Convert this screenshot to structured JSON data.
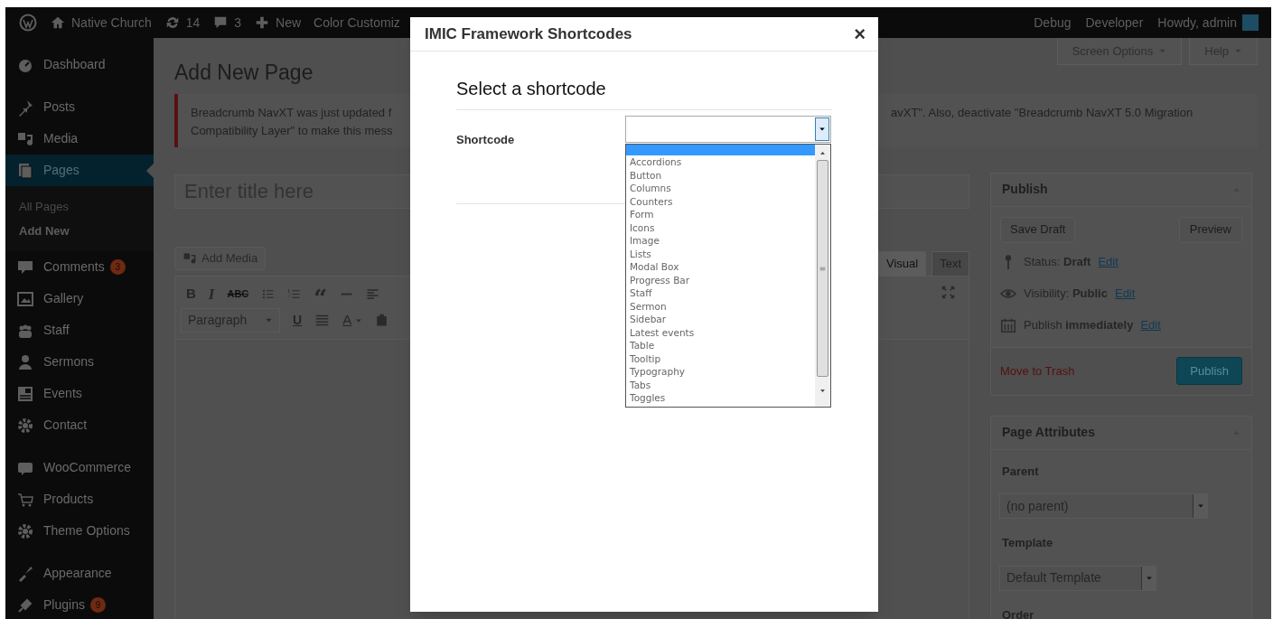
{
  "admin_bar": {
    "left": [
      {
        "label": "Native Church"
      },
      {
        "label": "14"
      },
      {
        "label": "3"
      },
      {
        "label": "New"
      },
      {
        "label": "Color Customiz"
      }
    ],
    "right": [
      "Debug",
      "Developer",
      "Howdy, admin"
    ]
  },
  "sidebar": {
    "groups": [
      [
        {
          "label": "Dashboard",
          "selected": false
        }
      ],
      [
        {
          "label": "Posts",
          "selected": false
        },
        {
          "label": "Media",
          "selected": false
        },
        {
          "label": "Pages",
          "selected": true,
          "children": [
            {
              "label": "All Pages",
              "selected": false
            },
            {
              "label": "Add New",
              "selected": true
            }
          ]
        },
        {
          "label": "Comments",
          "selected": false,
          "badge": "3"
        },
        {
          "label": "Gallery",
          "selected": false
        },
        {
          "label": "Staff",
          "selected": false
        },
        {
          "label": "Sermons",
          "selected": false
        },
        {
          "label": "Events",
          "selected": false
        },
        {
          "label": "Contact",
          "selected": false
        }
      ],
      [
        {
          "label": "WooCommerce",
          "selected": false
        },
        {
          "label": "Products",
          "selected": false
        },
        {
          "label": "Theme Options",
          "selected": false
        }
      ],
      [
        {
          "label": "Appearance",
          "selected": false
        },
        {
          "label": "Plugins",
          "selected": false,
          "badge": "9"
        }
      ]
    ]
  },
  "page_title": "Add New Page",
  "screen_tabs": [
    "Screen Options",
    "Help"
  ],
  "notice": {
    "left_lines": [
      "Breadcrumb NavXT was just updated f",
      "Compatibility Layer\" to make this mess"
    ],
    "right_lines": [
      "avXT\". Also, deactivate \"Breadcrumb NavXT 5.0 Migration"
    ]
  },
  "title_field": {
    "placeholder": "Enter title here"
  },
  "editor": {
    "add_media": "Add Media",
    "tabs": [
      {
        "label": "Visual",
        "selected": true
      },
      {
        "label": "Text",
        "selected": false
      }
    ],
    "glyphs": {
      "bold": "B",
      "italic": "I",
      "strike": "ABC",
      "quote": "“",
      "underline": "U",
      "text_color_letter": "A"
    },
    "format": "Paragraph"
  },
  "publish": {
    "title": "Publish",
    "save_draft": "Save Draft",
    "preview": "Preview",
    "rows": [
      {
        "label": "Status:",
        "value": "Draft",
        "link": "Edit"
      },
      {
        "label": "Visibility:",
        "value": "Public",
        "link": "Edit"
      },
      {
        "label": "Publish",
        "value": "immediately",
        "link": "Edit"
      }
    ],
    "trash": "Move to Trash",
    "publish_button": "Publish"
  },
  "page_attributes": {
    "title": "Page Attributes",
    "parent_label": "Parent",
    "parent_value": "(no parent)",
    "template_label": "Template",
    "template_value": "Default Template",
    "order_label": "Order"
  },
  "modal": {
    "title": "IMIC Framework Shortcodes",
    "close": "×",
    "heading": "Select a shortcode",
    "field_label": "Shortcode",
    "blank_option_highlighted": true,
    "options": [
      "Accordions",
      "Button",
      "Columns",
      "Counters",
      "Form",
      "Icons",
      "Image",
      "Lists",
      "Modal Box",
      "Progress Bar",
      "Staff",
      "Sermon",
      "Sidebar",
      "Latest events",
      "Table",
      "Tooltip",
      "Typography",
      "Tabs",
      "Toggles"
    ]
  }
}
